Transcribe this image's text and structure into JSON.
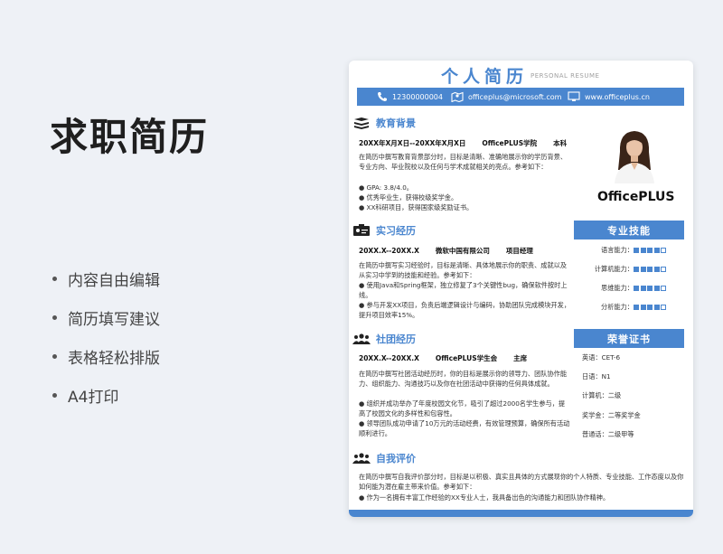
{
  "left": {
    "title": "求职简历",
    "features": [
      "内容自由编辑",
      "简历填写建议",
      "表格轻松排版",
      "A4打印"
    ]
  },
  "resume": {
    "title": "个人简历",
    "subtitle": "PERSONAL RESUME",
    "contact": {
      "phone": "12300000004",
      "email": "officeplus@microsoft.com",
      "web": "www.officeplus.cn"
    },
    "name": "OfficePLUS",
    "education": {
      "heading": "教育背景",
      "date": "20XX年X月X日--20XX年X月X日",
      "school": "OfficePLUS学院",
      "degree": "本科",
      "desc": "在简历中撰写教育背景部分时，目标是清晰、准确地展示你的学历背景、专业方向、毕业院校以及任何与学术成就相关的亮点。参考如下：",
      "bullets": [
        "● GPA: 3.8/4.0。",
        "● 优秀毕业生，获得校级奖学金。",
        "● XX科研项目，获得国家级奖励证书。"
      ]
    },
    "internship": {
      "heading": "实习经历",
      "date": "20XX.X--20XX.X",
      "company": "微软中国有限公司",
      "role": "项目经理",
      "desc": "在简历中撰写实习经验时，目标是清晰、具体地展示你的职责、成就以及从实习中学到的技能和经验。参考如下：",
      "bullets": [
        "● 使用Java和Spring框架，独立修复了3个关键性bug，确保软件按时上线。",
        "● 参与开发XX项目，负责后端逻辑设计与编码，协助团队完成模块开发，提升项目效率15%。"
      ]
    },
    "club": {
      "heading": "社团经历",
      "date": "20XX.X--20XX.X",
      "org": "OfficePLUS学生会",
      "role": "主席",
      "desc": "在简历中撰写社团活动经历时，你的目标是展示你的领导力、团队协作能力、组织能力、沟通技巧以及你在社团活动中获得的任何具体成就。",
      "bullets": [
        "● 组织并成功举办了年度校园文化节，吸引了超过2000名学生参与，提高了校园文化的多样性和包容性。",
        "● 领导团队成功申请了10万元的活动经费，有效管理预算，确保所有活动顺利进行。"
      ]
    },
    "self": {
      "heading": "自我评价",
      "desc": "在简历中撰写自我评价部分时，目标是以积极、真实且具体的方式展现你的个人特质、专业技能、工作态度以及你如何能为潜在雇主带来价值。参考如下：",
      "bullets": [
        "● 作为一名拥有丰富工作经验的XX专业人士，我具备出色的沟通能力和团队协作精神。"
      ]
    },
    "skills": {
      "heading": "专业技能",
      "items": [
        {
          "label": "语言能力：",
          "level": 4,
          "max": 5
        },
        {
          "label": "计算机能力：",
          "level": 4,
          "max": 5
        },
        {
          "label": "思维能力：",
          "level": 4,
          "max": 5
        },
        {
          "label": "分析能力：",
          "level": 4,
          "max": 5
        }
      ]
    },
    "honors": {
      "heading": "荣誉证书",
      "items": [
        "英语：CET-6",
        "日语：N1",
        "计算机：二级",
        "奖学金：二等奖学金",
        "普通话：二级甲等"
      ]
    }
  },
  "colors": {
    "accent": "#4a86cf",
    "background": "#eef1f6"
  }
}
